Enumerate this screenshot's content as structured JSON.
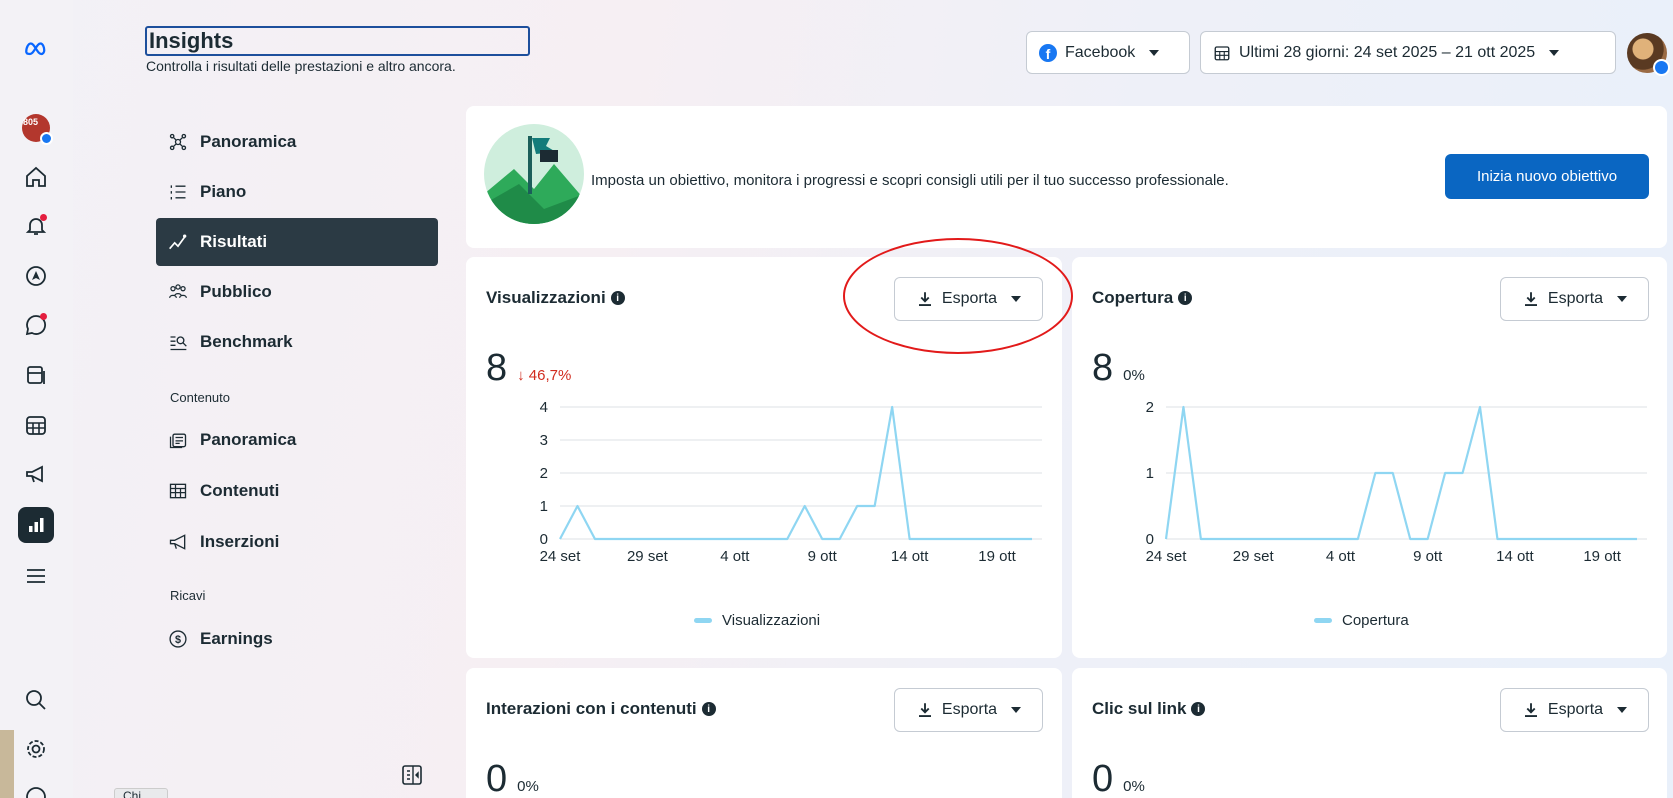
{
  "header": {
    "title": "Insights",
    "subtitle": "Controlla i risultati delle prestazioni e altro ancora.",
    "platform": "Facebook",
    "date_range": "Ultimi 28 giorni: 24 set 2025 – 21 ott 2025"
  },
  "rail": {
    "icons": [
      "meta-logo-icon",
      "page-avatar-icon",
      "home-icon",
      "notifications-icon",
      "explore-icon",
      "messages-icon",
      "posts-icon",
      "calendar-icon",
      "ads-icon",
      "insights-icon",
      "menu-icon",
      "search-icon",
      "settings-icon",
      "help-icon"
    ],
    "badge_text": "805"
  },
  "nav": {
    "items": [
      {
        "label": "Panoramica",
        "icon": "overview-icon"
      },
      {
        "label": "Piano",
        "icon": "plan-icon"
      },
      {
        "label": "Risultati",
        "icon": "results-icon"
      },
      {
        "label": "Pubblico",
        "icon": "audience-icon"
      },
      {
        "label": "Benchmark",
        "icon": "benchmark-icon"
      }
    ],
    "section_content": "Contenuto",
    "content_items": [
      {
        "label": "Panoramica",
        "icon": "content-overview-icon"
      },
      {
        "label": "Contenuti",
        "icon": "content-table-icon"
      },
      {
        "label": "Inserzioni",
        "icon": "ads-megaphone-icon"
      }
    ],
    "section_revenue": "Ricavi",
    "revenue_items": [
      {
        "label": "Earnings",
        "icon": "dollar-icon"
      }
    ],
    "tooltip": "Chi"
  },
  "goal": {
    "text": "Imposta un obiettivo, monitora i progressi e scopri consigli utili per il tuo successo professionale.",
    "button": "Inizia nuovo obiettivo"
  },
  "cards": {
    "views": {
      "title": "Visualizzazioni",
      "value": "8",
      "delta": "↓ 46,7%",
      "export": "Esporta",
      "legend": "Visualizzazioni"
    },
    "reach": {
      "title": "Copertura",
      "value": "8",
      "delta": "0%",
      "export": "Esporta",
      "legend": "Copertura"
    },
    "interactions": {
      "title": "Interazioni con i contenuti",
      "value": "0",
      "delta": "0%",
      "export": "Esporta"
    },
    "link_clicks": {
      "title": "Clic sul link",
      "value": "0",
      "delta": "0%",
      "export": "Esporta"
    }
  },
  "chart_data": [
    {
      "type": "line",
      "title": "Visualizzazioni",
      "x": [
        "24 set",
        "25 set",
        "26 set",
        "27 set",
        "28 set",
        "29 set",
        "30 set",
        "1 ott",
        "2 ott",
        "3 ott",
        "4 ott",
        "5 ott",
        "6 ott",
        "7 ott",
        "8 ott",
        "9 ott",
        "10 ott",
        "11 ott",
        "12 ott",
        "13 ott",
        "14 ott",
        "15 ott",
        "16 ott",
        "17 ott",
        "18 ott",
        "19 ott",
        "20 ott",
        "21 ott"
      ],
      "x_ticks": [
        "24 set",
        "29 set",
        "4 ott",
        "9 ott",
        "14 ott",
        "19 ott"
      ],
      "series": [
        {
          "name": "Visualizzazioni",
          "color": "#8fd6f2",
          "values": [
            0,
            1,
            0,
            0,
            0,
            0,
            0,
            0,
            0,
            0,
            0,
            0,
            0,
            0,
            1,
            0,
            0,
            1,
            1,
            4,
            0,
            0,
            0,
            0,
            0,
            0,
            0,
            0
          ]
        }
      ],
      "ylim": [
        0,
        4
      ],
      "y_ticks": [
        0,
        1,
        2,
        3,
        4
      ]
    },
    {
      "type": "line",
      "title": "Copertura",
      "x": [
        "24 set",
        "25 set",
        "26 set",
        "27 set",
        "28 set",
        "29 set",
        "30 set",
        "1 ott",
        "2 ott",
        "3 ott",
        "4 ott",
        "5 ott",
        "6 ott",
        "7 ott",
        "8 ott",
        "9 ott",
        "10 ott",
        "11 ott",
        "12 ott",
        "13 ott",
        "14 ott",
        "15 ott",
        "16 ott",
        "17 ott",
        "18 ott",
        "19 ott",
        "20 ott",
        "21 ott"
      ],
      "x_ticks": [
        "24 set",
        "29 set",
        "4 ott",
        "9 ott",
        "14 ott",
        "19 ott"
      ],
      "series": [
        {
          "name": "Copertura",
          "color": "#8fd6f2",
          "values": [
            0,
            2,
            0,
            0,
            0,
            0,
            0,
            0,
            0,
            0,
            0,
            0,
            1,
            1,
            0,
            0,
            1,
            1,
            2,
            0,
            0,
            0,
            0,
            0,
            0,
            0,
            0,
            0
          ]
        }
      ],
      "ylim": [
        0,
        2
      ],
      "y_ticks": [
        0,
        1,
        2
      ]
    }
  ]
}
